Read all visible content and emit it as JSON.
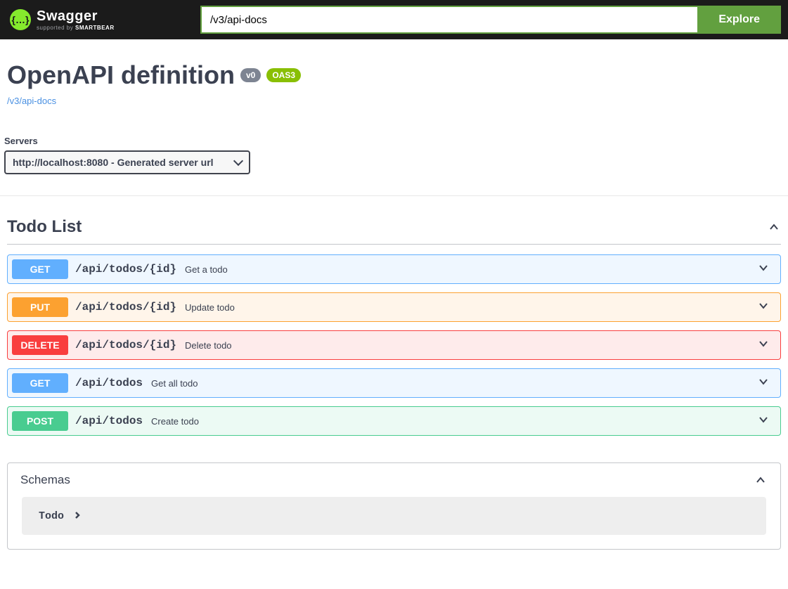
{
  "topbar": {
    "logo_text": "Swagger",
    "logo_subtitle_prefix": "supported by ",
    "logo_subtitle_brand": "SMARTBEAR",
    "url_value": "/v3/api-docs",
    "explore_label": "Explore"
  },
  "info": {
    "title": "OpenAPI definition",
    "version_badge": "v0",
    "oas_badge": "OAS3",
    "docs_link": "/v3/api-docs"
  },
  "servers": {
    "label": "Servers",
    "selected": "http://localhost:8080 - Generated server url"
  },
  "tag": {
    "name": "Todo List"
  },
  "operations": [
    {
      "method": "GET",
      "path": "/api/todos/{id}",
      "summary": "Get a todo"
    },
    {
      "method": "PUT",
      "path": "/api/todos/{id}",
      "summary": "Update todo"
    },
    {
      "method": "DELETE",
      "path": "/api/todos/{id}",
      "summary": "Delete todo"
    },
    {
      "method": "GET",
      "path": "/api/todos",
      "summary": "Get all todo"
    },
    {
      "method": "POST",
      "path": "/api/todos",
      "summary": "Create todo"
    }
  ],
  "schemas": {
    "title": "Schemas",
    "items": [
      {
        "name": "Todo"
      }
    ]
  }
}
